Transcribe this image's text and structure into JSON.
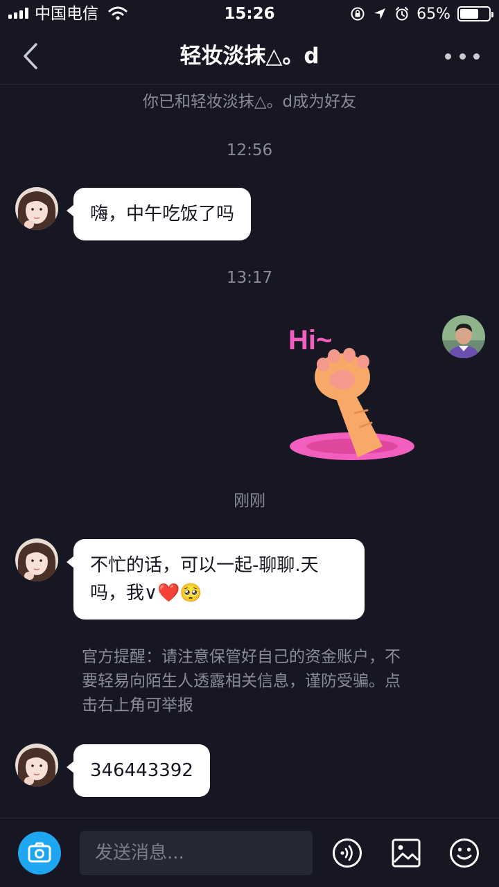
{
  "status_bar": {
    "carrier": "中国电信",
    "time": "15:26",
    "battery_percent": "65%",
    "battery_level": 0.65
  },
  "header": {
    "title": "轻妆淡抹△。d",
    "back_icon": "chevron-left-icon",
    "more_icon": "more-dots-icon"
  },
  "chat": {
    "friend_notice": "你已和轻妆淡抹△。d成为好友",
    "time_1": "12:56",
    "msg_1": "嗨，中午吃饭了吗",
    "time_2": "13:17",
    "sticker_text": "Hi~",
    "time_3": "刚刚",
    "msg_2_line1": "不忙的话，可以一起-聊聊.天",
    "msg_2_line2_prefix": "吗，我∨",
    "msg_2_heart": "❤️",
    "msg_2_face": "🥺",
    "official_notice": "官方提醒：请注意保管好自己的资金账户，不要轻易向陌生人透露相关信息，谨防受骗。点击右上角可举报",
    "msg_3": "346443392"
  },
  "input_bar": {
    "placeholder": "发送消息...",
    "camera_icon": "camera-icon",
    "voice_icon": "voice-icon",
    "image_icon": "image-icon",
    "emoji_icon": "emoji-icon"
  },
  "colors": {
    "background": "#161723",
    "bubble": "#ffffff",
    "accent_camera": "#1fa6f0",
    "sticker_pink": "#f35fbf",
    "paw_orange": "#f8a96a"
  }
}
